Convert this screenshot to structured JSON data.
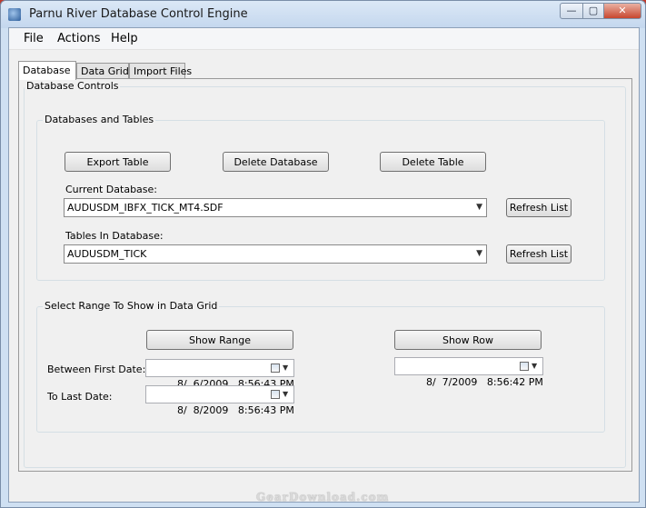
{
  "window": {
    "title": "Parnu River Database Control Engine",
    "controls": {
      "minimize": "—",
      "maximize": "▢",
      "close": "✕"
    }
  },
  "menu": [
    "File",
    "Actions",
    "Help"
  ],
  "tabs": [
    {
      "label": "Database",
      "active": true
    },
    {
      "label": "Data Grid",
      "active": false
    },
    {
      "label": "Import Files",
      "active": false
    }
  ],
  "database_controls": {
    "title": "Database Controls",
    "databases_tables": {
      "title": "Databases and Tables",
      "export_table": "Export Table",
      "delete_database": "Delete Database",
      "delete_table": "Delete Table",
      "current_database_label": "Current Database:",
      "current_database_value": "AUDUSDM_IBFX_TICK_MT4.SDF",
      "refresh_list_1": "Refresh List",
      "tables_label": "Tables In Database:",
      "tables_value": "AUDUSDM_TICK",
      "refresh_list_2": "Refresh List"
    },
    "range": {
      "title": "Select Range To Show in Data Grid",
      "show_range": "Show Range",
      "show_row": "Show Row",
      "first_date_label": "Between First Date:",
      "first_date_value": "8/  6/2009   8:56:43 PM",
      "last_date_label": "To Last Date:",
      "last_date_value": "8/  8/2009   8:56:43 PM",
      "row_date_value": "8/  7/2009   8:56:42 PM"
    }
  },
  "watermark": "GearDownload.com"
}
